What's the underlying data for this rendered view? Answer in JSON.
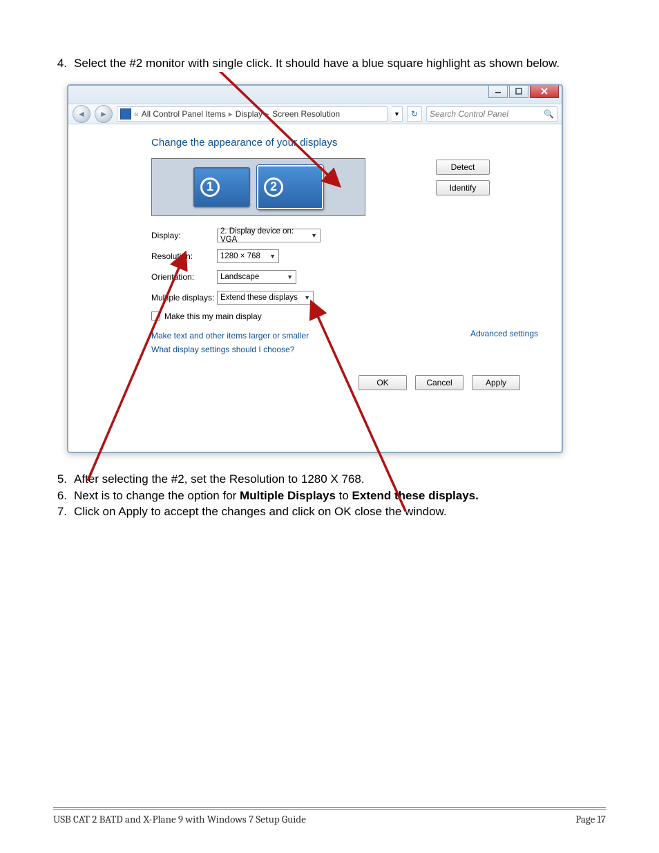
{
  "steps": {
    "s4": {
      "num": "4.",
      "text": "Select the #2 monitor with single click. It should have a blue square highlight as shown below."
    },
    "s5": {
      "num": "5.",
      "text": "After selecting the #2, set the Resolution to 1280 X 768."
    },
    "s6": {
      "num": "6.",
      "prefix": "Next is to change the option for ",
      "bold1": "Multiple Displays",
      "mid": " to ",
      "bold2": "Extend these displays."
    },
    "s7": {
      "num": "7.",
      "text": "Click on Apply to accept the changes and click on OK close the window."
    }
  },
  "window": {
    "breadcrumb": {
      "root_sep": "«",
      "level1": "All Control Panel Items",
      "level2": "Display",
      "level3": "Screen Resolution"
    },
    "search_placeholder": "Search Control Panel",
    "heading": "Change the appearance of your displays",
    "monitors": {
      "m1": "1",
      "m2": "2"
    },
    "buttons": {
      "detect": "Detect",
      "identify": "Identify",
      "ok": "OK",
      "cancel": "Cancel",
      "apply": "Apply"
    },
    "fields": {
      "display": {
        "label": "Display:",
        "value": "2. Display device on: VGA"
      },
      "resolution": {
        "label": "Resolution:",
        "value": "1280 × 768"
      },
      "orientation": {
        "label": "Orientation:",
        "value": "Landscape"
      },
      "multiple_displays": {
        "label": "Multiple displays:",
        "value": "Extend these displays"
      }
    },
    "checkbox_label": "Make this my main display",
    "links": {
      "larger_smaller": "Make text and other items larger or smaller",
      "which_settings": "What display settings should I choose?",
      "advanced": "Advanced settings"
    }
  },
  "footer": {
    "title": "USB CAT 2 BATD and X-Plane 9 with Windows 7 Setup Guide",
    "page": "Page 17"
  }
}
